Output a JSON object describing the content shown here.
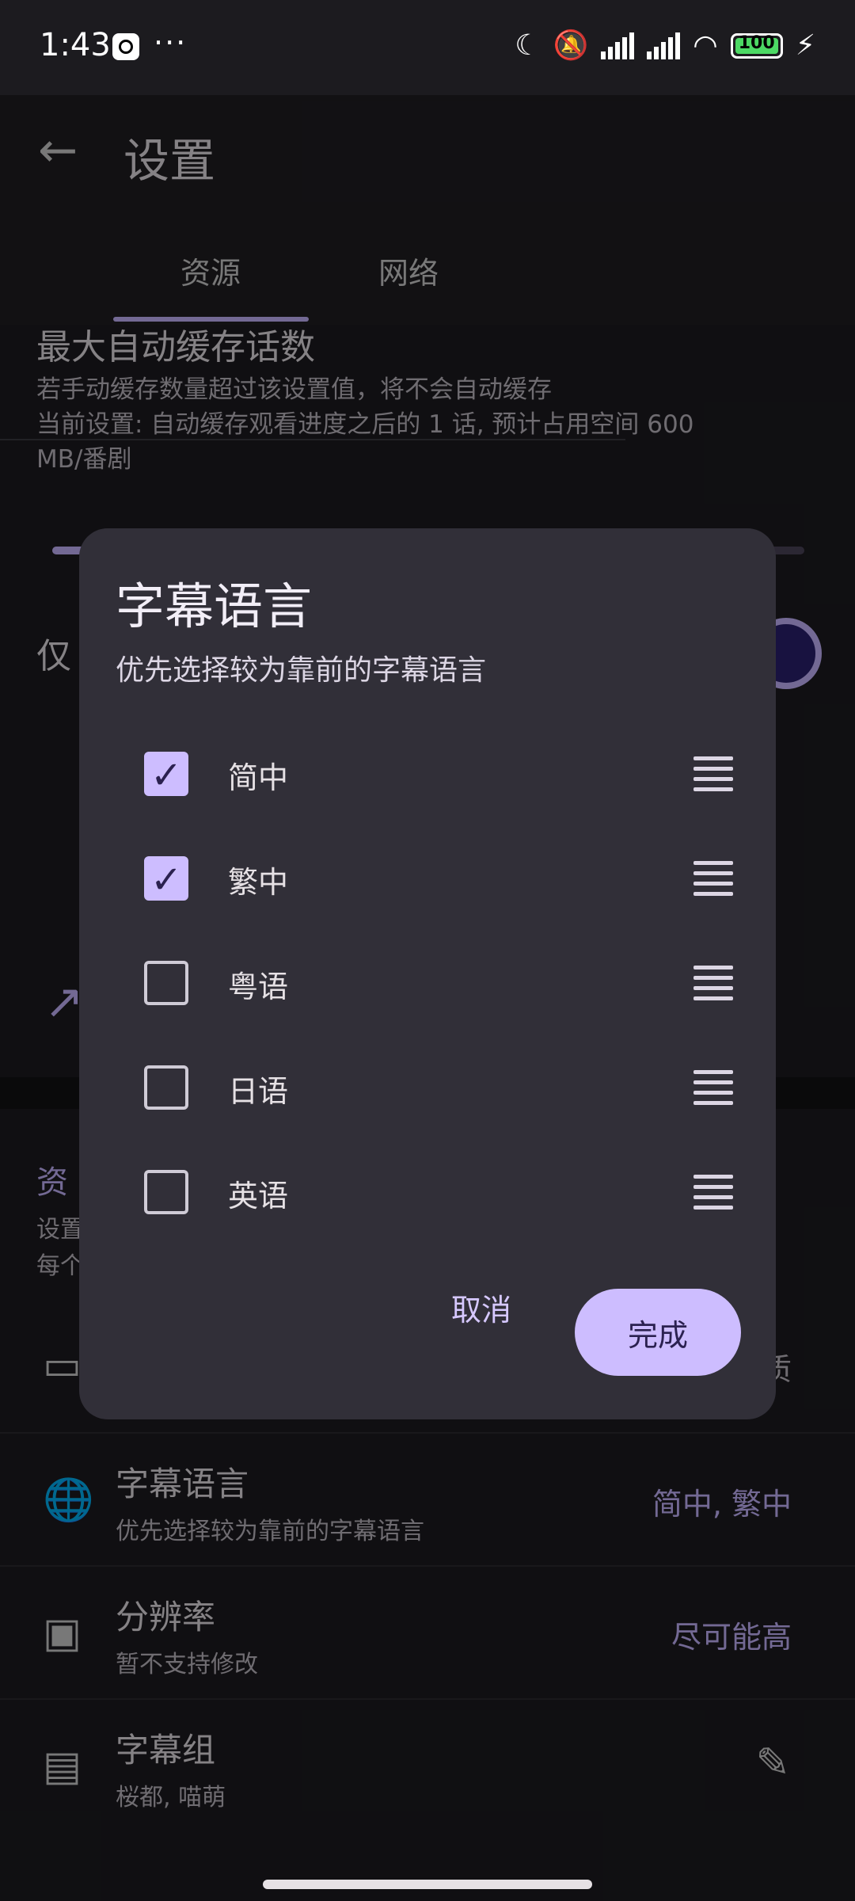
{
  "status_bar": {
    "time": "1:43",
    "more": "···",
    "battery": "100"
  },
  "app_bar": {
    "title": "设置"
  },
  "tabs": [
    {
      "label": "资源"
    },
    {
      "label": "网络"
    }
  ],
  "background": {
    "max_cache": {
      "title": "最大自动缓存话数",
      "desc_line1": "若手动缓存数量超过该设置值，将不会自动缓存",
      "desc_line2": "当前设置: 自动缓存观看进度之后的 1 话, 预计占用空间 600",
      "desc_line3": "MB/番剧"
    },
    "row_partial_1": "仅",
    "resource_section": {
      "title": "资",
      "desc_line1": "设置",
      "desc_line2": "每个"
    },
    "pref_partial_value": "质",
    "prefs": [
      {
        "title": "字幕语言",
        "subtitle": "优先选择较为靠前的字幕语言",
        "value": "简中, 繁中",
        "icon": "globe-icon"
      },
      {
        "title": "分辨率",
        "subtitle": "暂不支持修改",
        "value": "尽可能高",
        "icon": "hd-icon"
      },
      {
        "title": "字幕组",
        "subtitle": "桜都, 喵萌",
        "value": "",
        "icon": "subtitles-icon"
      }
    ]
  },
  "dialog": {
    "title": "字幕语言",
    "subtitle": "优先选择较为靠前的字幕语言",
    "options": [
      {
        "label": "简中",
        "checked": true
      },
      {
        "label": "繁中",
        "checked": true
      },
      {
        "label": "粤语",
        "checked": false
      },
      {
        "label": "日语",
        "checked": false
      },
      {
        "label": "英语",
        "checked": false
      }
    ],
    "cancel_label": "取消",
    "confirm_label": "完成"
  },
  "colors": {
    "accent": "#cdbdff",
    "dialog_bg": "#312f38",
    "background": "#1c1b1f"
  }
}
